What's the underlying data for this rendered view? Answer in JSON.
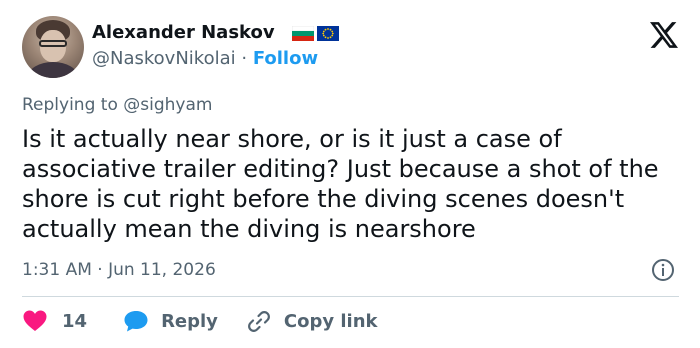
{
  "author": {
    "name": "Alexander Naskov",
    "handle": "@NaskovNikolai",
    "separator": "·",
    "follow_label": "Follow",
    "flags": [
      "bulgaria-flag-icon",
      "eu-flag-icon"
    ]
  },
  "reply": {
    "replying_to": "Replying to @sighyam"
  },
  "tweet": {
    "text": "Is it actually near shore, or is it just a case of associative trailer editing? Just because a shot of the shore is cut right before the diving scenes doesn't actually mean the diving is nearshore",
    "timestamp": "1:31 AM · Jun 11, 2026"
  },
  "actions": {
    "like_count": "14",
    "reply_label": "Reply",
    "copy_label": "Copy link"
  },
  "colors": {
    "accent": "#1d9bf0",
    "like": "#f91880",
    "secondary_text": "#536471",
    "text": "#0f1419",
    "divider": "#cfd9de"
  }
}
